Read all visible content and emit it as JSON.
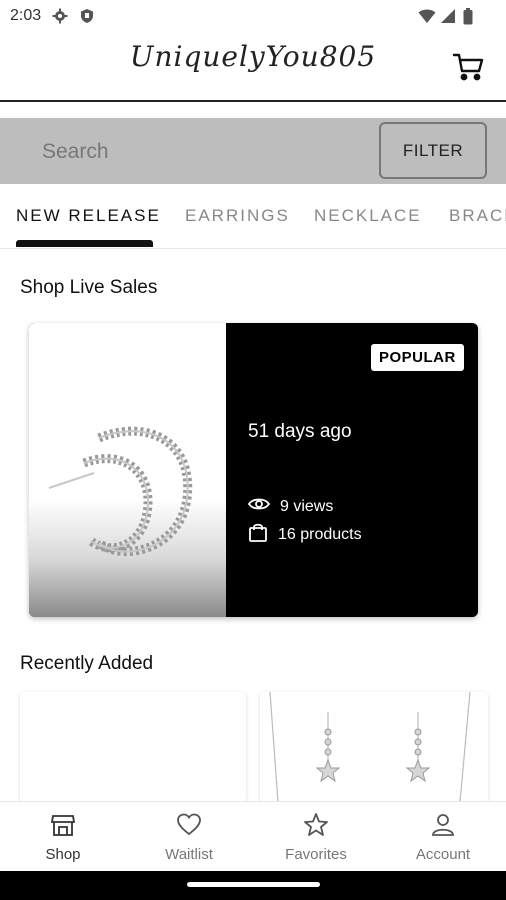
{
  "status_bar": {
    "time": "2:03",
    "icons": [
      "gear-icon",
      "shield-icon",
      "wifi-icon",
      "signal-icon",
      "battery-icon"
    ]
  },
  "header": {
    "logo_text": "UniquelyYou805",
    "cart_icon": "cart-icon"
  },
  "search": {
    "placeholder": "Search",
    "filter_label": "FILTER"
  },
  "tabs": [
    {
      "label": "NEW RELEASE",
      "active": true
    },
    {
      "label": "EARRINGS",
      "active": false
    },
    {
      "label": "NECKLACE",
      "active": false
    },
    {
      "label": "BRACE",
      "active": false
    }
  ],
  "live_sales": {
    "title": "Shop Live Sales",
    "card": {
      "badge": "POPULAR",
      "posted": "51 days ago",
      "views": "9 views",
      "products": "16 products"
    }
  },
  "recently_added": {
    "title": "Recently Added"
  },
  "bottom_nav": [
    {
      "label": "Shop",
      "icon": "shop-icon",
      "active": true
    },
    {
      "label": "Waitlist",
      "icon": "heart-icon",
      "active": false
    },
    {
      "label": "Favorites",
      "icon": "star-icon",
      "active": false
    },
    {
      "label": "Account",
      "icon": "account-icon",
      "active": false
    }
  ],
  "colors": {
    "search_band": "#bdbdbd",
    "card_info_bg": "#000000",
    "accent": "#111111",
    "inactive_text": "#888888"
  }
}
